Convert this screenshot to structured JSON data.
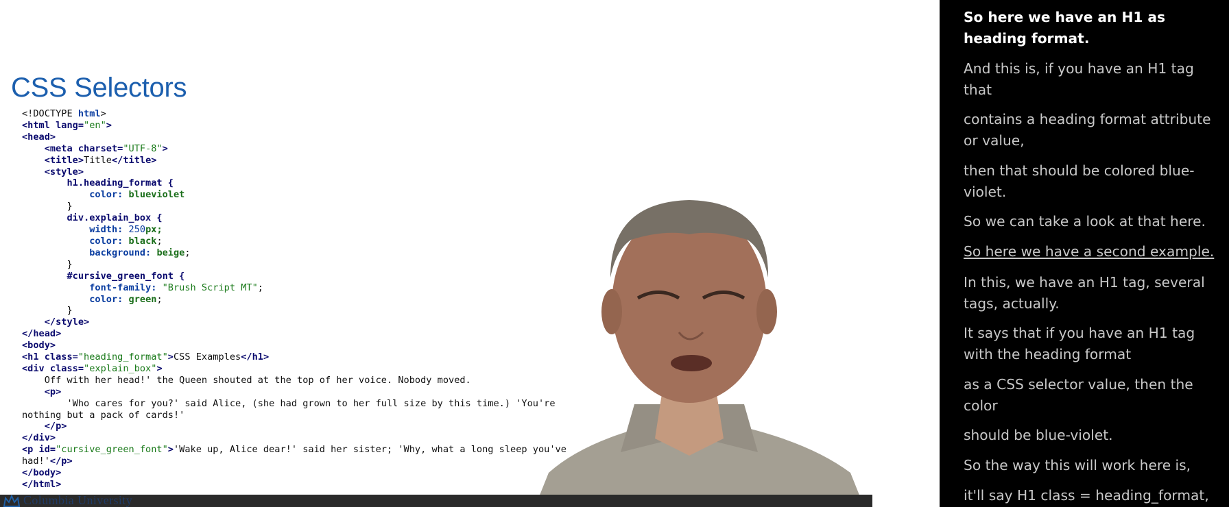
{
  "slide": {
    "title": "CSS Selectors",
    "logo_text": "Columbia University",
    "code": {
      "l1a": "<!DOCTYPE ",
      "l1b": "html",
      "l1c": ">",
      "l2a": "<html lang=",
      "l2b": "\"en\"",
      "l2c": ">",
      "l3": "<head>",
      "l4a": "<meta charset=",
      "l4b": "\"UTF-8\"",
      "l4c": ">",
      "l5a": "<title>",
      "l5b": "Title",
      "l5c": "</title>",
      "l6": "<style>",
      "l7": "h1.heading_format {",
      "l8a": "color: ",
      "l8b": "blueviolet",
      "l9": "}",
      "l10": "div.explain_box {",
      "l11a": "width: ",
      "l11b": "250",
      "l11c": "px;",
      "l12a": "color: ",
      "l12b": "black",
      "l12c": ";",
      "l13a": "background: ",
      "l13b": "beige",
      "l13c": ";",
      "l14": "}",
      "l15": "#cursive_green_font {",
      "l16a": "font-family: ",
      "l16b": "\"Brush Script MT\"",
      "l16c": ";",
      "l17a": "color: ",
      "l17b": "green",
      "l17c": ";",
      "l18": "}",
      "l19": "</style>",
      "l20": "</head>",
      "l21": "<body>",
      "l22a": "<h1 class=",
      "l22b": "\"heading_format\"",
      "l22c": ">",
      "l22d": "CSS Examples",
      "l22e": "</h1>",
      "l23a": "<div class=",
      "l23b": "\"explain_box\"",
      "l23c": ">",
      "l24": "Off with her head!' the Queen shouted at the top of her voice. Nobody moved.",
      "l25": "<p>",
      "l26": "'Who cares for you?' said Alice, (she had grown to her full size by this time.) 'You're",
      "l27": "nothing but a pack of cards!'",
      "l28": "</p>",
      "l29": "</div>",
      "l30a": "<p id=",
      "l30b": "\"cursive_green_font\"",
      "l30c": ">",
      "l30d": "'Wake up, Alice dear!' said her sister; 'Why, what a long sleep you've",
      "l31a": "had!'",
      "l31b": "</p>",
      "l32": "</body>",
      "l33": "</html>"
    }
  },
  "transcript": {
    "cues": [
      "So here we have an H1 as heading format.",
      "And this is, if you have an H1 tag that",
      "contains a heading format attribute or value,",
      "then that should be colored blue-violet.",
      "So we can take a look at that here.",
      "So here we have a second example.",
      "In this, we have an H1 tag, several tags, actually.",
      "It says that if you have an H1 tag with the heading format",
      "as a CSS selector value, then the color",
      "should be blue-violet.",
      "So the way this will work here is,",
      "it'll say H1 class = heading_format,"
    ]
  },
  "colors": {
    "slide_title": "#1c5fae",
    "transcript_bg": "#000000",
    "transcript_text": "#c8c8c8",
    "transcript_active": "#ffffff"
  },
  "icons": [
    "columbia-crown-icon"
  ]
}
